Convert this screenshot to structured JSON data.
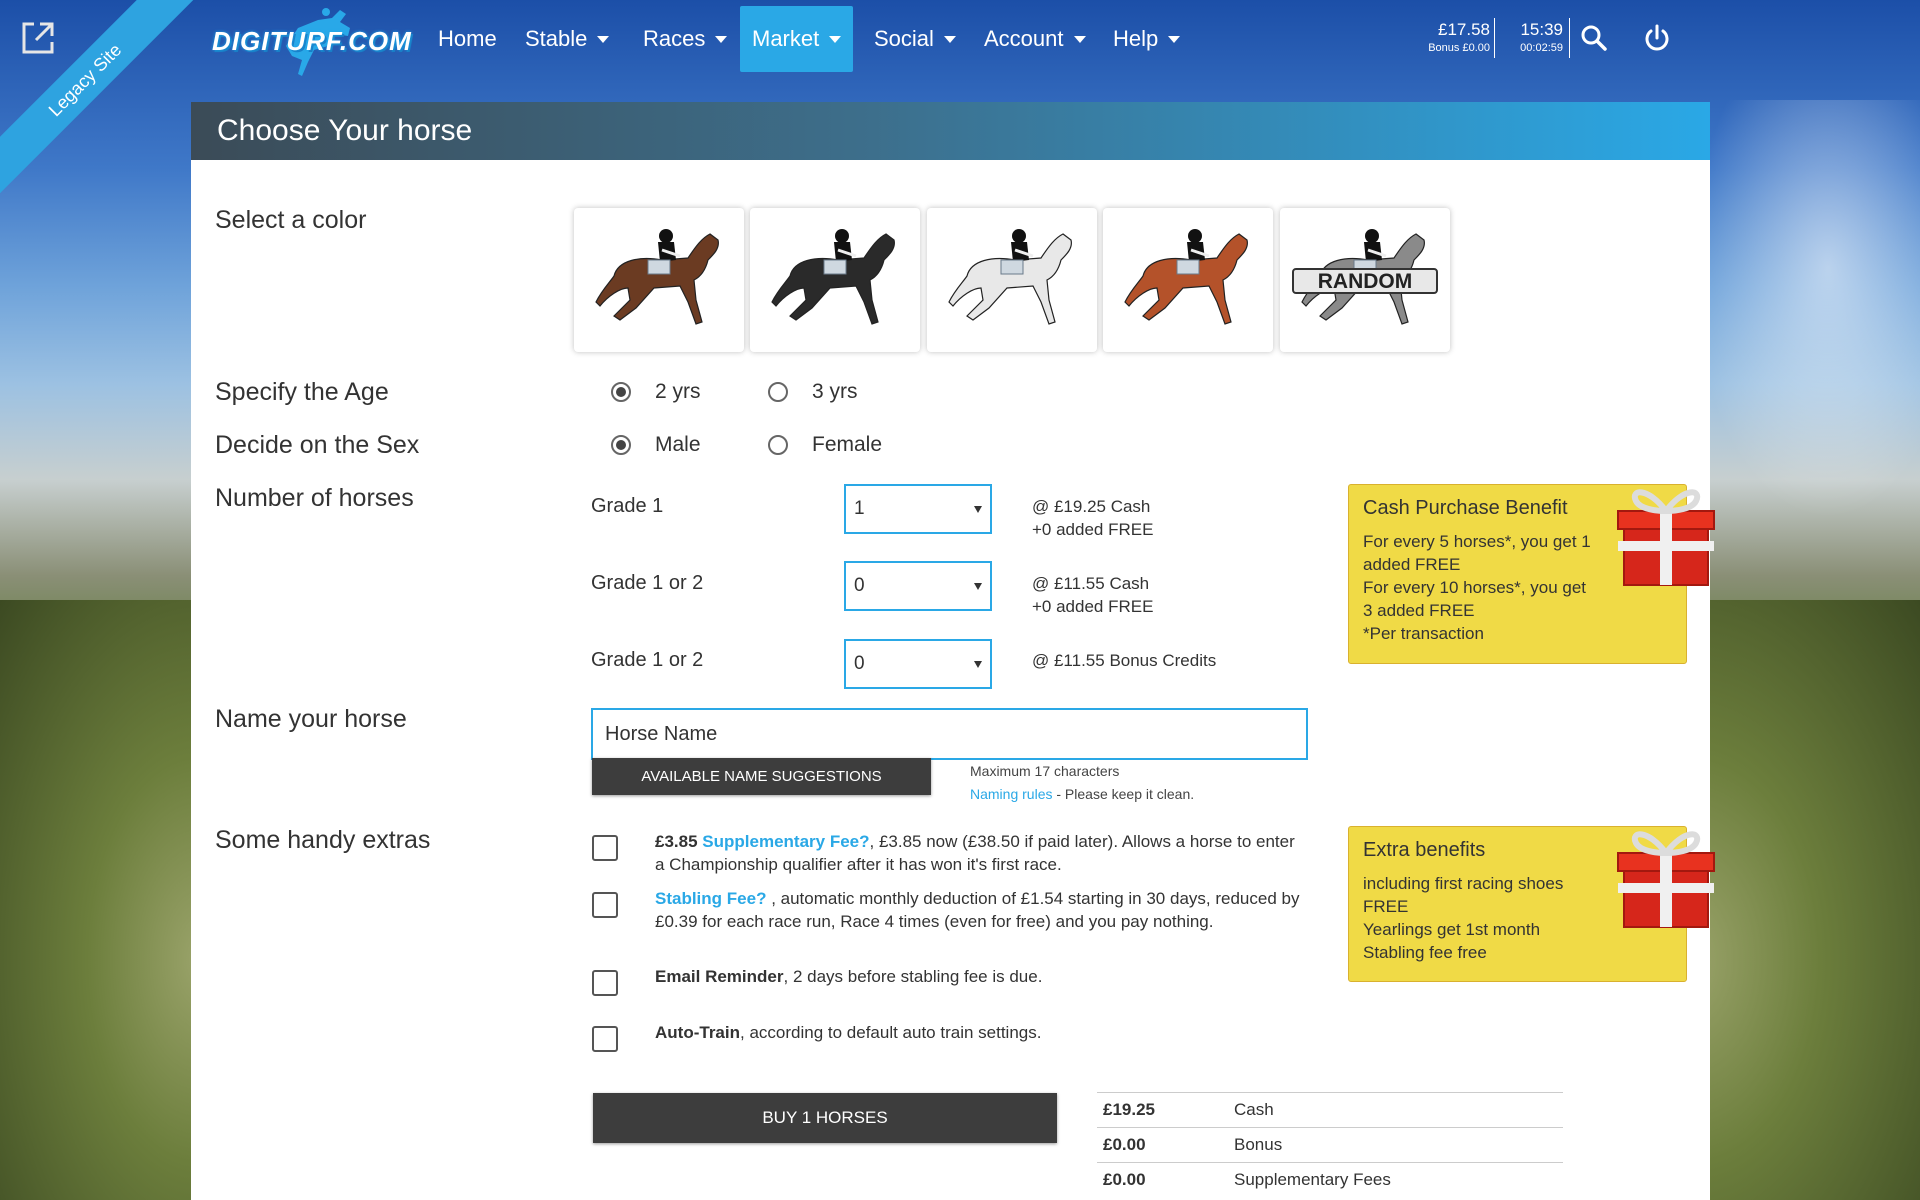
{
  "ribbon": {
    "label": "Legacy Site"
  },
  "nav": {
    "logo": "DIGITURF.COM",
    "items": [
      {
        "label": "Home",
        "caret": false,
        "active": false
      },
      {
        "label": "Stable",
        "caret": true,
        "active": false
      },
      {
        "label": "Races",
        "caret": true,
        "active": false
      },
      {
        "label": "Market",
        "caret": true,
        "active": true
      },
      {
        "label": "Social",
        "caret": true,
        "active": false
      },
      {
        "label": "Account",
        "caret": true,
        "active": false
      },
      {
        "label": "Help",
        "caret": true,
        "active": false
      }
    ],
    "balance": "£17.58",
    "bonus": "Bonus £0.00",
    "time": "15:39",
    "timer": "00:02:59",
    "icons": [
      "search-icon",
      "power-icon"
    ]
  },
  "page": {
    "title": "Choose Your horse"
  },
  "color": {
    "label": "Select a color",
    "swatches": [
      {
        "name": "bay",
        "coat": "#6b3b22"
      },
      {
        "name": "black",
        "coat": "#2a2a2a"
      },
      {
        "name": "grey",
        "coat": "#e8e8e8"
      },
      {
        "name": "chestnut",
        "coat": "#b4522a"
      },
      {
        "name": "random",
        "coat": "#8a8a8a",
        "text": "RANDOM"
      }
    ]
  },
  "age": {
    "label": "Specify the Age",
    "options": [
      "2 yrs",
      "3 yrs"
    ],
    "selected": "2 yrs"
  },
  "sex": {
    "label": "Decide on the Sex",
    "options": [
      "Male",
      "Female"
    ],
    "selected": "Male"
  },
  "horses": {
    "label": "Number of horses",
    "rows": [
      {
        "grade": "Grade 1",
        "value": "1",
        "price": "@ £19.25 Cash",
        "extra": "+0  added FREE"
      },
      {
        "grade": "Grade 1 or 2",
        "value": "0",
        "price": "@ £11.55 Cash",
        "extra": "+0  added FREE"
      },
      {
        "grade": "Grade 1 or 2",
        "value": "0",
        "price": "@ £11.55 Bonus Credits",
        "extra": ""
      }
    ]
  },
  "cash_benefit": {
    "title": "Cash Purchase Benefit",
    "lines": [
      "For every 5 horses*, you get 1",
      "added FREE",
      "For every 10 horses*, you get",
      "3 added FREE",
      "*Per transaction"
    ]
  },
  "name": {
    "label": "Name your horse",
    "value": "Horse Name",
    "suggest_button": "AVAILABLE NAME SUGGESTIONS",
    "max_hint": "Maximum 17 characters",
    "rules_link": "Naming rules",
    "rules_hint": " - Please keep it clean."
  },
  "extras": {
    "label": "Some handy extras",
    "items": [
      {
        "prefix": "£3.85",
        "link": "Supplementary Fee?",
        "text": ", £3.85 now (£38.50 if paid later). Allows a horse to enter a Championship qualifier after it has won it's first race."
      },
      {
        "prefix": "",
        "link": "Stabling Fee?",
        "text": " , automatic monthly deduction of £1.54 starting in 30 days, reduced by £0.39 for each race run, Race 4 times (even for free) and you pay nothing."
      },
      {
        "prefix": "Email Reminder",
        "link": "",
        "text": ", 2 days before stabling fee is due."
      },
      {
        "prefix": "Auto-Train",
        "link": "",
        "text": ", according to default auto train settings."
      }
    ]
  },
  "extra_benefit": {
    "title": "Extra benefits",
    "lines": [
      "including first racing shoes",
      "FREE",
      "Yearlings get 1st month",
      "Stabling fee free"
    ]
  },
  "buy": {
    "label": "BUY 1 HORSES"
  },
  "summary": [
    {
      "amount": "£19.25",
      "label": "Cash"
    },
    {
      "amount": "£0.00",
      "label": "Bonus"
    },
    {
      "amount": "£0.00",
      "label": "Supplementary Fees"
    }
  ]
}
